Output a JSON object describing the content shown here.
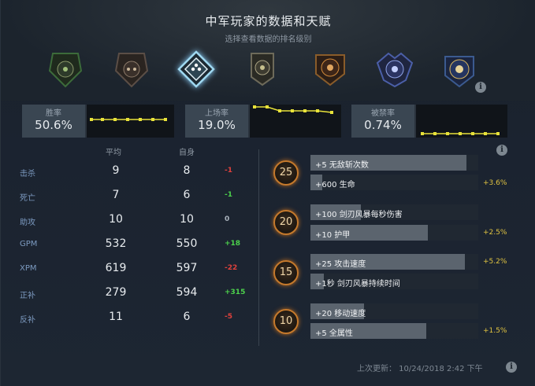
{
  "header": {
    "title": "中军玩家的数据和天赋",
    "subtitle": "选择查看数据的排名级别"
  },
  "medals": [
    {
      "name": "medal-1",
      "selected": false,
      "color": "#3c6b3a"
    },
    {
      "name": "medal-2",
      "selected": false,
      "color": "#5b4e46"
    },
    {
      "name": "medal-3",
      "selected": true,
      "color": "#6fb7d8"
    },
    {
      "name": "medal-4",
      "selected": false,
      "color": "#6d6a5a"
    },
    {
      "name": "medal-5",
      "selected": false,
      "color": "#8a5c2a"
    },
    {
      "name": "medal-6",
      "selected": false,
      "color": "#4b5fa8"
    },
    {
      "name": "medal-7",
      "selected": false,
      "color": "#3b5a8f"
    }
  ],
  "stats": {
    "win_rate": {
      "label": "胜率",
      "value": "50.6%"
    },
    "pick_rate": {
      "label": "上场率",
      "value": "19.0%"
    },
    "ban_rate": {
      "label": "被禁率",
      "value": "0.74%"
    }
  },
  "table": {
    "avg_header": "平均",
    "self_header": "自身",
    "rows": [
      {
        "label": "击杀",
        "avg": "9",
        "self": "8",
        "delta": "-1",
        "sign": "neg"
      },
      {
        "label": "死亡",
        "avg": "7",
        "self": "6",
        "delta": "-1",
        "sign": "pos"
      },
      {
        "label": "助攻",
        "avg": "10",
        "self": "10",
        "delta": "0",
        "sign": "zero"
      },
      {
        "label": "GPM",
        "avg": "532",
        "self": "550",
        "delta": "+18",
        "sign": "pos"
      },
      {
        "label": "XPM",
        "avg": "619",
        "self": "597",
        "delta": "-22",
        "sign": "neg"
      },
      {
        "label": "正补",
        "avg": "279",
        "self": "594",
        "delta": "+315",
        "sign": "pos"
      },
      {
        "label": "反补",
        "avg": "11",
        "self": "6",
        "delta": "-5",
        "sign": "neg"
      }
    ]
  },
  "talents": [
    {
      "level": "25",
      "top": {
        "text": "+5 无敌斩次数",
        "fill": 0.93,
        "pct": ""
      },
      "bottom": {
        "text": "+600 生命",
        "fill": 0.07,
        "pct": "+3.6%"
      }
    },
    {
      "level": "20",
      "top": {
        "text": "+100 剑刃风暴每秒伤害",
        "fill": 0.3,
        "pct": ""
      },
      "bottom": {
        "text": "+10 护甲",
        "fill": 0.7,
        "pct": "+2.5%"
      }
    },
    {
      "level": "15",
      "top": {
        "text": "+25 攻击速度",
        "fill": 0.92,
        "pct": "+5.2%"
      },
      "bottom": {
        "text": "+1秒 剑刃风暴持续时间",
        "fill": 0.08,
        "pct": ""
      }
    },
    {
      "level": "10",
      "top": {
        "text": "+20 移动速度",
        "fill": 0.32,
        "pct": ""
      },
      "bottom": {
        "text": "+5 全属性",
        "fill": 0.69,
        "pct": "+1.5%"
      }
    }
  ],
  "footer": {
    "last_updated": "上次更新： 10/24/2018 2:42 下午"
  }
}
